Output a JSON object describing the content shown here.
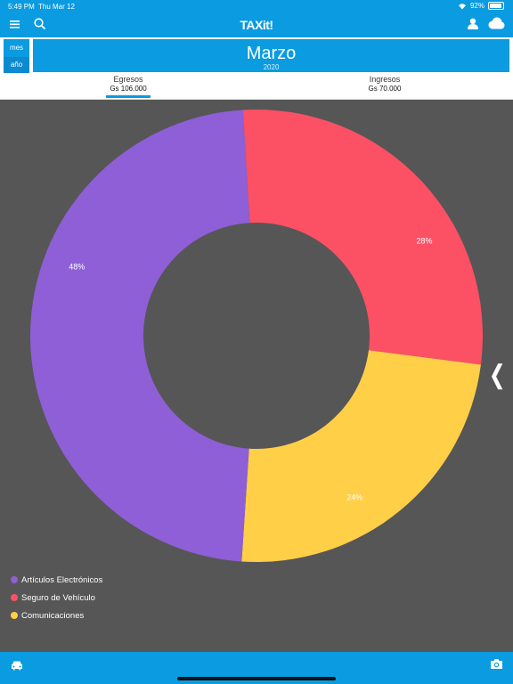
{
  "status": {
    "time": "5:49 PM",
    "date": "Thu Mar 12",
    "battery": "92%",
    "battery_level": 0.92
  },
  "nav": {
    "logo": "TAXit!"
  },
  "period": {
    "mes_label": "mes",
    "ano_label": "año",
    "month": "Marzo",
    "year": "2020"
  },
  "tabs": [
    {
      "label": "Egresos",
      "value": "Gs 106.000",
      "selected": true
    },
    {
      "label": "Ingresos",
      "value": "Gs 70.000",
      "selected": false
    }
  ],
  "chart_data": {
    "type": "pie",
    "donut": true,
    "categories": [
      "Artículos Electrónicos",
      "Seguro de Vehículo",
      "Comunicaciones"
    ],
    "values": [
      48,
      28,
      24
    ],
    "labels": [
      "48%",
      "28%",
      "24%"
    ],
    "colors": [
      "#8e5fd6",
      "#fc5064",
      "#ffcf47"
    ],
    "legend_position": "bottom-left"
  },
  "colors": {
    "accent": "#0a9be0",
    "background": "#565656"
  },
  "icons": [
    "menu-icon",
    "search-icon",
    "user-icon",
    "cloud-icon",
    "car-icon",
    "camera-icon",
    "chevron-left-icon"
  ]
}
